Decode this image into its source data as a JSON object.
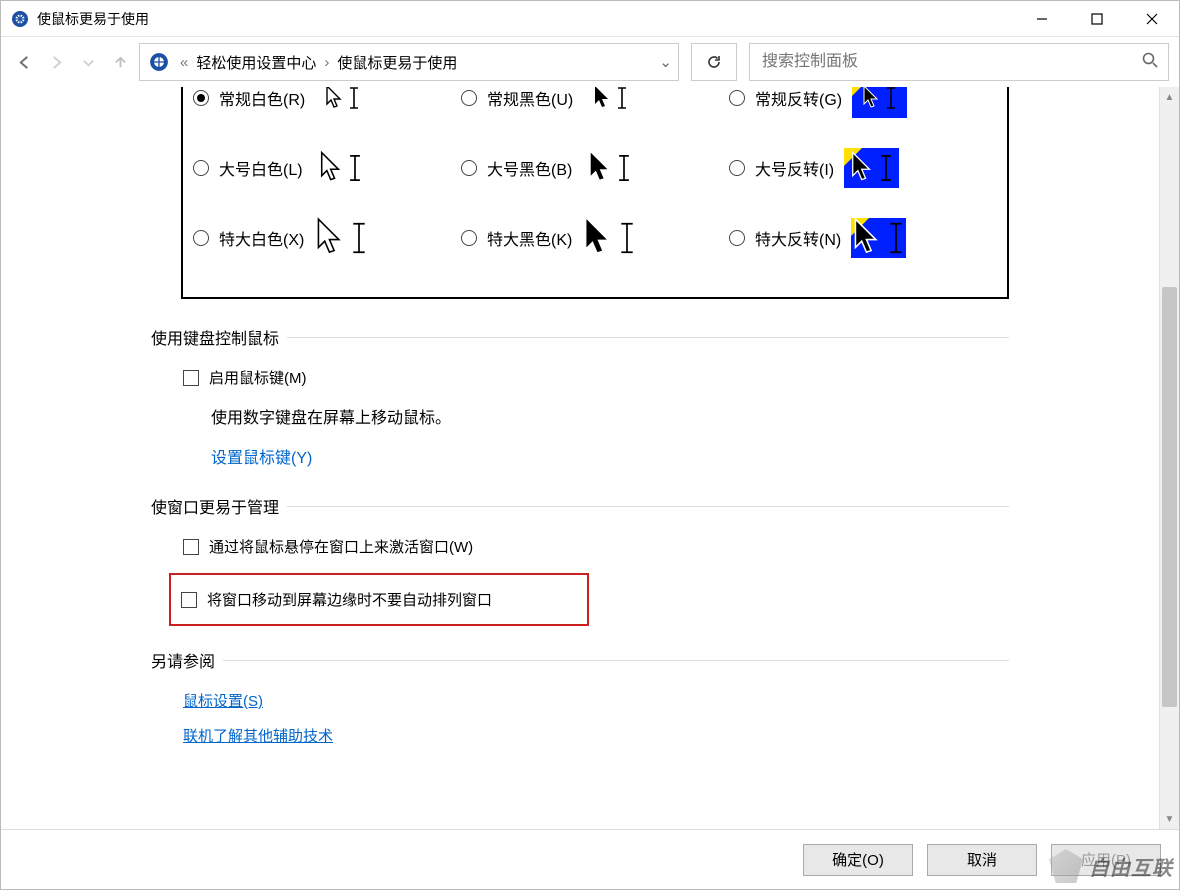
{
  "window": {
    "title": "使鼠标更易于使用"
  },
  "breadcrumb": {
    "prefix": "«",
    "item1": "轻松使用设置中心",
    "item2": "使鼠标更易于使用"
  },
  "search": {
    "placeholder": "搜索控制面板"
  },
  "cursors": {
    "row0_opt1": "常规白色(R)",
    "row0_opt2": "常规黑色(U)",
    "row0_opt3": "常规反转(G)",
    "row1_opt1": "大号白色(L)",
    "row1_opt2": "大号黑色(B)",
    "row1_opt3": "大号反转(I)",
    "row2_opt1": "特大白色(X)",
    "row2_opt2": "特大黑色(K)",
    "row2_opt3": "特大反转(N)",
    "selected": "row0_opt1"
  },
  "section_keyboard": {
    "title": "使用键盘控制鼠标",
    "enable_label": "启用鼠标键(M)",
    "desc": "使用数字键盘在屏幕上移动鼠标。",
    "link": "设置鼠标键(Y)"
  },
  "section_window": {
    "title": "使窗口更易于管理",
    "hover_label": "通过将鼠标悬停在窗口上来激活窗口(W)",
    "snap_label": "将窗口移动到屏幕边缘时不要自动排列窗口"
  },
  "section_see_also": {
    "title": "另请参阅",
    "link1": "鼠标设置(S)",
    "link2": "联机了解其他辅助技术"
  },
  "footer": {
    "ok": "确定(O)",
    "cancel": "取消",
    "apply": "应用(P)"
  },
  "watermark": "自由互联"
}
